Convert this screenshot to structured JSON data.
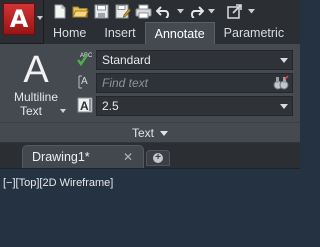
{
  "app": {
    "logo_letter": "A",
    "brand_color": "#c82020"
  },
  "quick_access": {
    "icons": [
      "new-file-icon",
      "open-folder-icon",
      "save-icon",
      "save-as-icon",
      "plot-printer-icon",
      "undo-icon",
      "redo-icon",
      "share-icon",
      "customize-dropdown-icon"
    ]
  },
  "ribbon_tabs": [
    {
      "label": "Home",
      "active": false
    },
    {
      "label": "Insert",
      "active": false
    },
    {
      "label": "Annotate",
      "active": true
    },
    {
      "label": "Parametric",
      "active": false
    }
  ],
  "text_panel": {
    "multiline_glyph": "A",
    "multiline_label_1": "Multiline",
    "multiline_label_2": "Text",
    "text_style_value": "Standard",
    "find_text_placeholder": "Find text",
    "text_height_value": "2.5",
    "abc_icon_label": "ABC",
    "panel_title": "Text"
  },
  "file_tabs": {
    "active_tab_label": "Drawing1*",
    "close_glyph": "✕",
    "new_tab_glyph": "+"
  },
  "viewport": {
    "controls_label": "[−]",
    "view_label": "[Top]",
    "visual_style_label": "[2D Wireframe]"
  },
  "colors": {
    "ribbon_bg": "#454a51",
    "canvas_bg": "#243241",
    "check_green": "#4fb04a"
  }
}
